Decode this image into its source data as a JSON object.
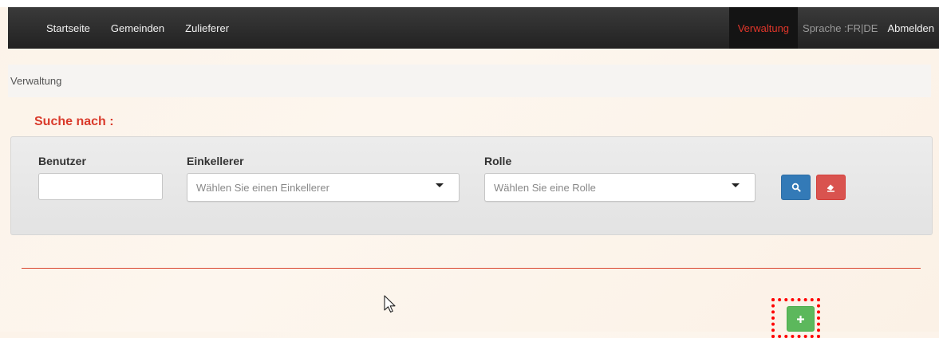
{
  "nav": {
    "items": [
      {
        "label": "Startseite"
      },
      {
        "label": "Gemeinden"
      },
      {
        "label": "Zulieferer"
      }
    ],
    "active_label": "Verwaltung",
    "language_label": "Sprache :FR|DE",
    "logout_label": "Abmelden"
  },
  "breadcrumb": {
    "label": "Verwaltung"
  },
  "search": {
    "title": "Suche nach :",
    "user_label": "Benutzer",
    "user_value": "",
    "cellar_label": "Einkellerer",
    "cellar_placeholder": "Wählen Sie einen Einkellerer",
    "role_label": "Rolle",
    "role_placeholder": "Wählen Sie eine Rolle"
  },
  "icons": {
    "search_button": "search-icon",
    "reset_button": "eraser-icon",
    "add_button": "plus-icon"
  },
  "colors": {
    "accent": "#d93a2b",
    "primary": "#337ab7",
    "danger": "#d9534f",
    "success": "#5cb85c",
    "navbar": "#222222"
  }
}
